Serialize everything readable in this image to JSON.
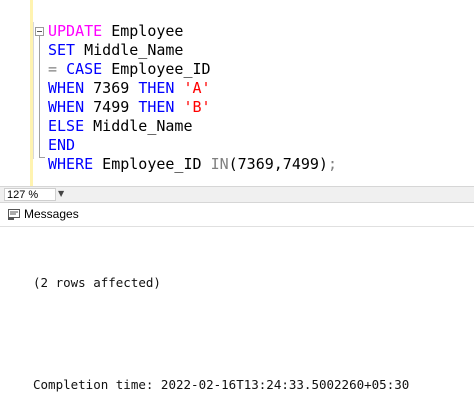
{
  "editor": {
    "lines": [
      [
        {
          "t": "UPDATE",
          "c": "fn"
        },
        {
          "t": " Employee",
          "c": "id"
        }
      ],
      [
        {
          "t": "SET",
          "c": "kw"
        },
        {
          "t": " Middle_Name",
          "c": "id"
        }
      ],
      [
        {
          "t": "=",
          "c": "gray"
        },
        {
          "t": " ",
          "c": "id"
        },
        {
          "t": "CASE",
          "c": "kw"
        },
        {
          "t": " Employee_ID",
          "c": "id"
        }
      ],
      [
        {
          "t": "WHEN",
          "c": "kw"
        },
        {
          "t": " 7369 ",
          "c": "id"
        },
        {
          "t": "THEN",
          "c": "kw"
        },
        {
          "t": " ",
          "c": "id"
        },
        {
          "t": "'A'",
          "c": "str"
        }
      ],
      [
        {
          "t": "WHEN",
          "c": "kw"
        },
        {
          "t": " 7499 ",
          "c": "id"
        },
        {
          "t": "THEN",
          "c": "kw"
        },
        {
          "t": " ",
          "c": "id"
        },
        {
          "t": "'B'",
          "c": "str"
        }
      ],
      [
        {
          "t": "ELSE",
          "c": "kw"
        },
        {
          "t": " Middle_Name",
          "c": "id"
        }
      ],
      [
        {
          "t": "END",
          "c": "kw"
        }
      ],
      [
        {
          "t": "WHERE",
          "c": "kw"
        },
        {
          "t": " Employee_ID ",
          "c": "id"
        },
        {
          "t": "IN",
          "c": "gray"
        },
        {
          "t": "(7369,7499)",
          "c": "id"
        },
        {
          "t": ";",
          "c": "gray"
        }
      ]
    ]
  },
  "status": {
    "zoom": "127 %"
  },
  "results": {
    "tab_label": "Messages",
    "rows_affected": "(2 rows affected)",
    "completion": "Completion time: 2022-02-16T13:24:33.5002260+05:30"
  },
  "colors": {
    "keyword": "#0000ff",
    "function": "#ff00ff",
    "string": "#ff0000",
    "operator": "#808080"
  }
}
